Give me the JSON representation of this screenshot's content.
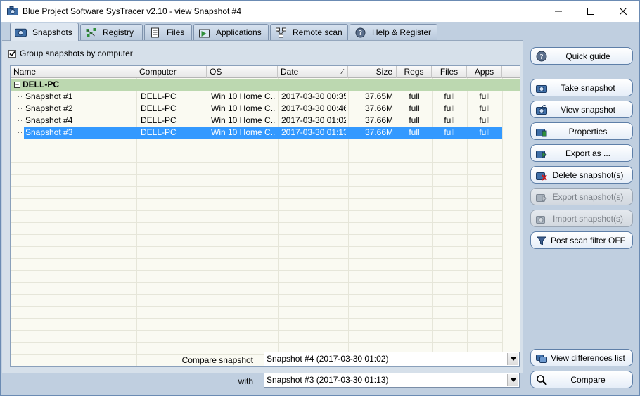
{
  "window": {
    "title": "Blue Project Software SysTracer v2.10 - view Snapshot #4",
    "controls": {
      "minimize": "minimize",
      "maximize": "maximize",
      "close": "close"
    }
  },
  "tabs": [
    {
      "label": "Snapshots",
      "icon": "camera-icon",
      "active": true
    },
    {
      "label": "Registry",
      "icon": "registry-icon",
      "active": false
    },
    {
      "label": "Files",
      "icon": "files-icon",
      "active": false
    },
    {
      "label": "Applications",
      "icon": "applications-icon",
      "active": false
    },
    {
      "label": "Remote scan",
      "icon": "network-icon",
      "active": false
    },
    {
      "label": "Help & Register",
      "icon": "help-icon",
      "active": false
    }
  ],
  "group_checkbox": {
    "label": "Group snapshots by computer",
    "checked": true
  },
  "list": {
    "columns": [
      "Name",
      "Computer",
      "OS",
      "Date",
      "Size",
      "Regs",
      "Files",
      "Apps"
    ],
    "sort_column": "Date",
    "group": {
      "name": "DELL-PC",
      "expander": "−"
    },
    "rows": [
      {
        "name": "Snapshot #1",
        "computer": "DELL-PC",
        "os": "Win 10 Home C...",
        "date": "2017-03-30 00:35",
        "size": "37.65M",
        "regs": "full",
        "files": "full",
        "apps": "full",
        "selected": false
      },
      {
        "name": "Snapshot #2",
        "computer": "DELL-PC",
        "os": "Win 10 Home C...",
        "date": "2017-03-30 00:46",
        "size": "37.66M",
        "regs": "full",
        "files": "full",
        "apps": "full",
        "selected": false
      },
      {
        "name": "Snapshot #4",
        "computer": "DELL-PC",
        "os": "Win 10 Home C...",
        "date": "2017-03-30 01:02",
        "size": "37.66M",
        "regs": "full",
        "files": "full",
        "apps": "full",
        "selected": false
      },
      {
        "name": "Snapshot #3",
        "computer": "DELL-PC",
        "os": "Win 10 Home C...",
        "date": "2017-03-30 01:13",
        "size": "37.66M",
        "regs": "full",
        "files": "full",
        "apps": "full",
        "selected": true
      }
    ]
  },
  "side_buttons": {
    "quick_guide": "Quick guide",
    "take_snapshot": "Take snapshot",
    "view_snapshot": "View snapshot",
    "properties": "Properties",
    "export_as": "Export as ...",
    "delete_snapshots": "Delete snapshot(s)",
    "export_snapshots": "Export snapshot(s)",
    "import_snapshots": "Import snapshot(s)",
    "post_scan_filter": "Post scan filter OFF",
    "view_differences": "View differences list",
    "compare": "Compare"
  },
  "compare": {
    "label": "Compare snapshot",
    "with_label": "with",
    "snapshot_value": "Snapshot #4 (2017-03-30 01:02)",
    "with_value": "Snapshot #3 (2017-03-30 01:13)"
  },
  "colors": {
    "client_bg": "#c0cfe0",
    "group_row": "#bcd8b0",
    "selection": "#3399ff",
    "list_bg": "#fafaf2"
  }
}
